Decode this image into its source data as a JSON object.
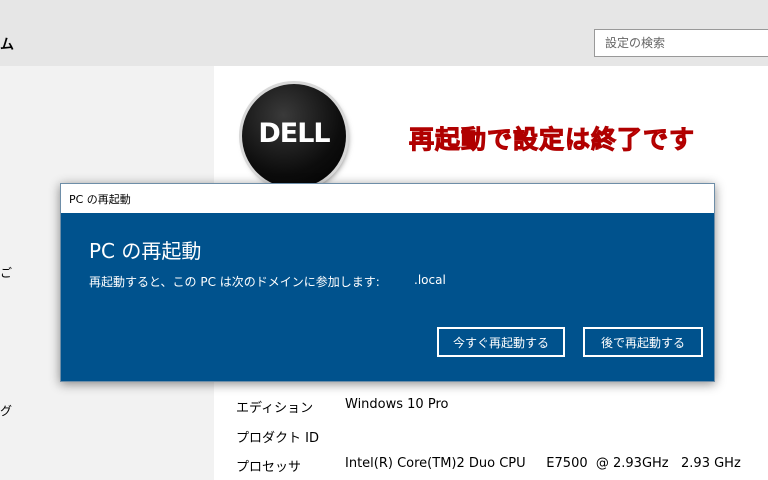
{
  "header": {
    "title_fragment": "ム",
    "search_placeholder": "設定の検索"
  },
  "nav": {
    "fragments": [
      "ご",
      "グ"
    ]
  },
  "logo": {
    "text": "DELL"
  },
  "annotation": "再起動で設定は終了です",
  "dialog": {
    "window_title": "PC の再起動",
    "heading": "PC の再起動",
    "message": "再起動すると、この PC は次のドメインに参加します:",
    "domain": ".local",
    "restart_now_label": "今すぐ再起動する",
    "restart_later_label": "後で再起動する"
  },
  "specs": [
    {
      "label": "エディション",
      "value": "Windows 10 Pro"
    },
    {
      "label": "プロダクト ID",
      "value": ""
    },
    {
      "label": "プロセッサ",
      "value": "Intel(R) Core(TM)2 Duo CPU     E7500  @ 2.93GHz   2.93 GHz"
    }
  ],
  "colors": {
    "dialog_bg": "#00528d",
    "annotation": "#ff1a1a",
    "header_bg": "#e6e6e6"
  }
}
